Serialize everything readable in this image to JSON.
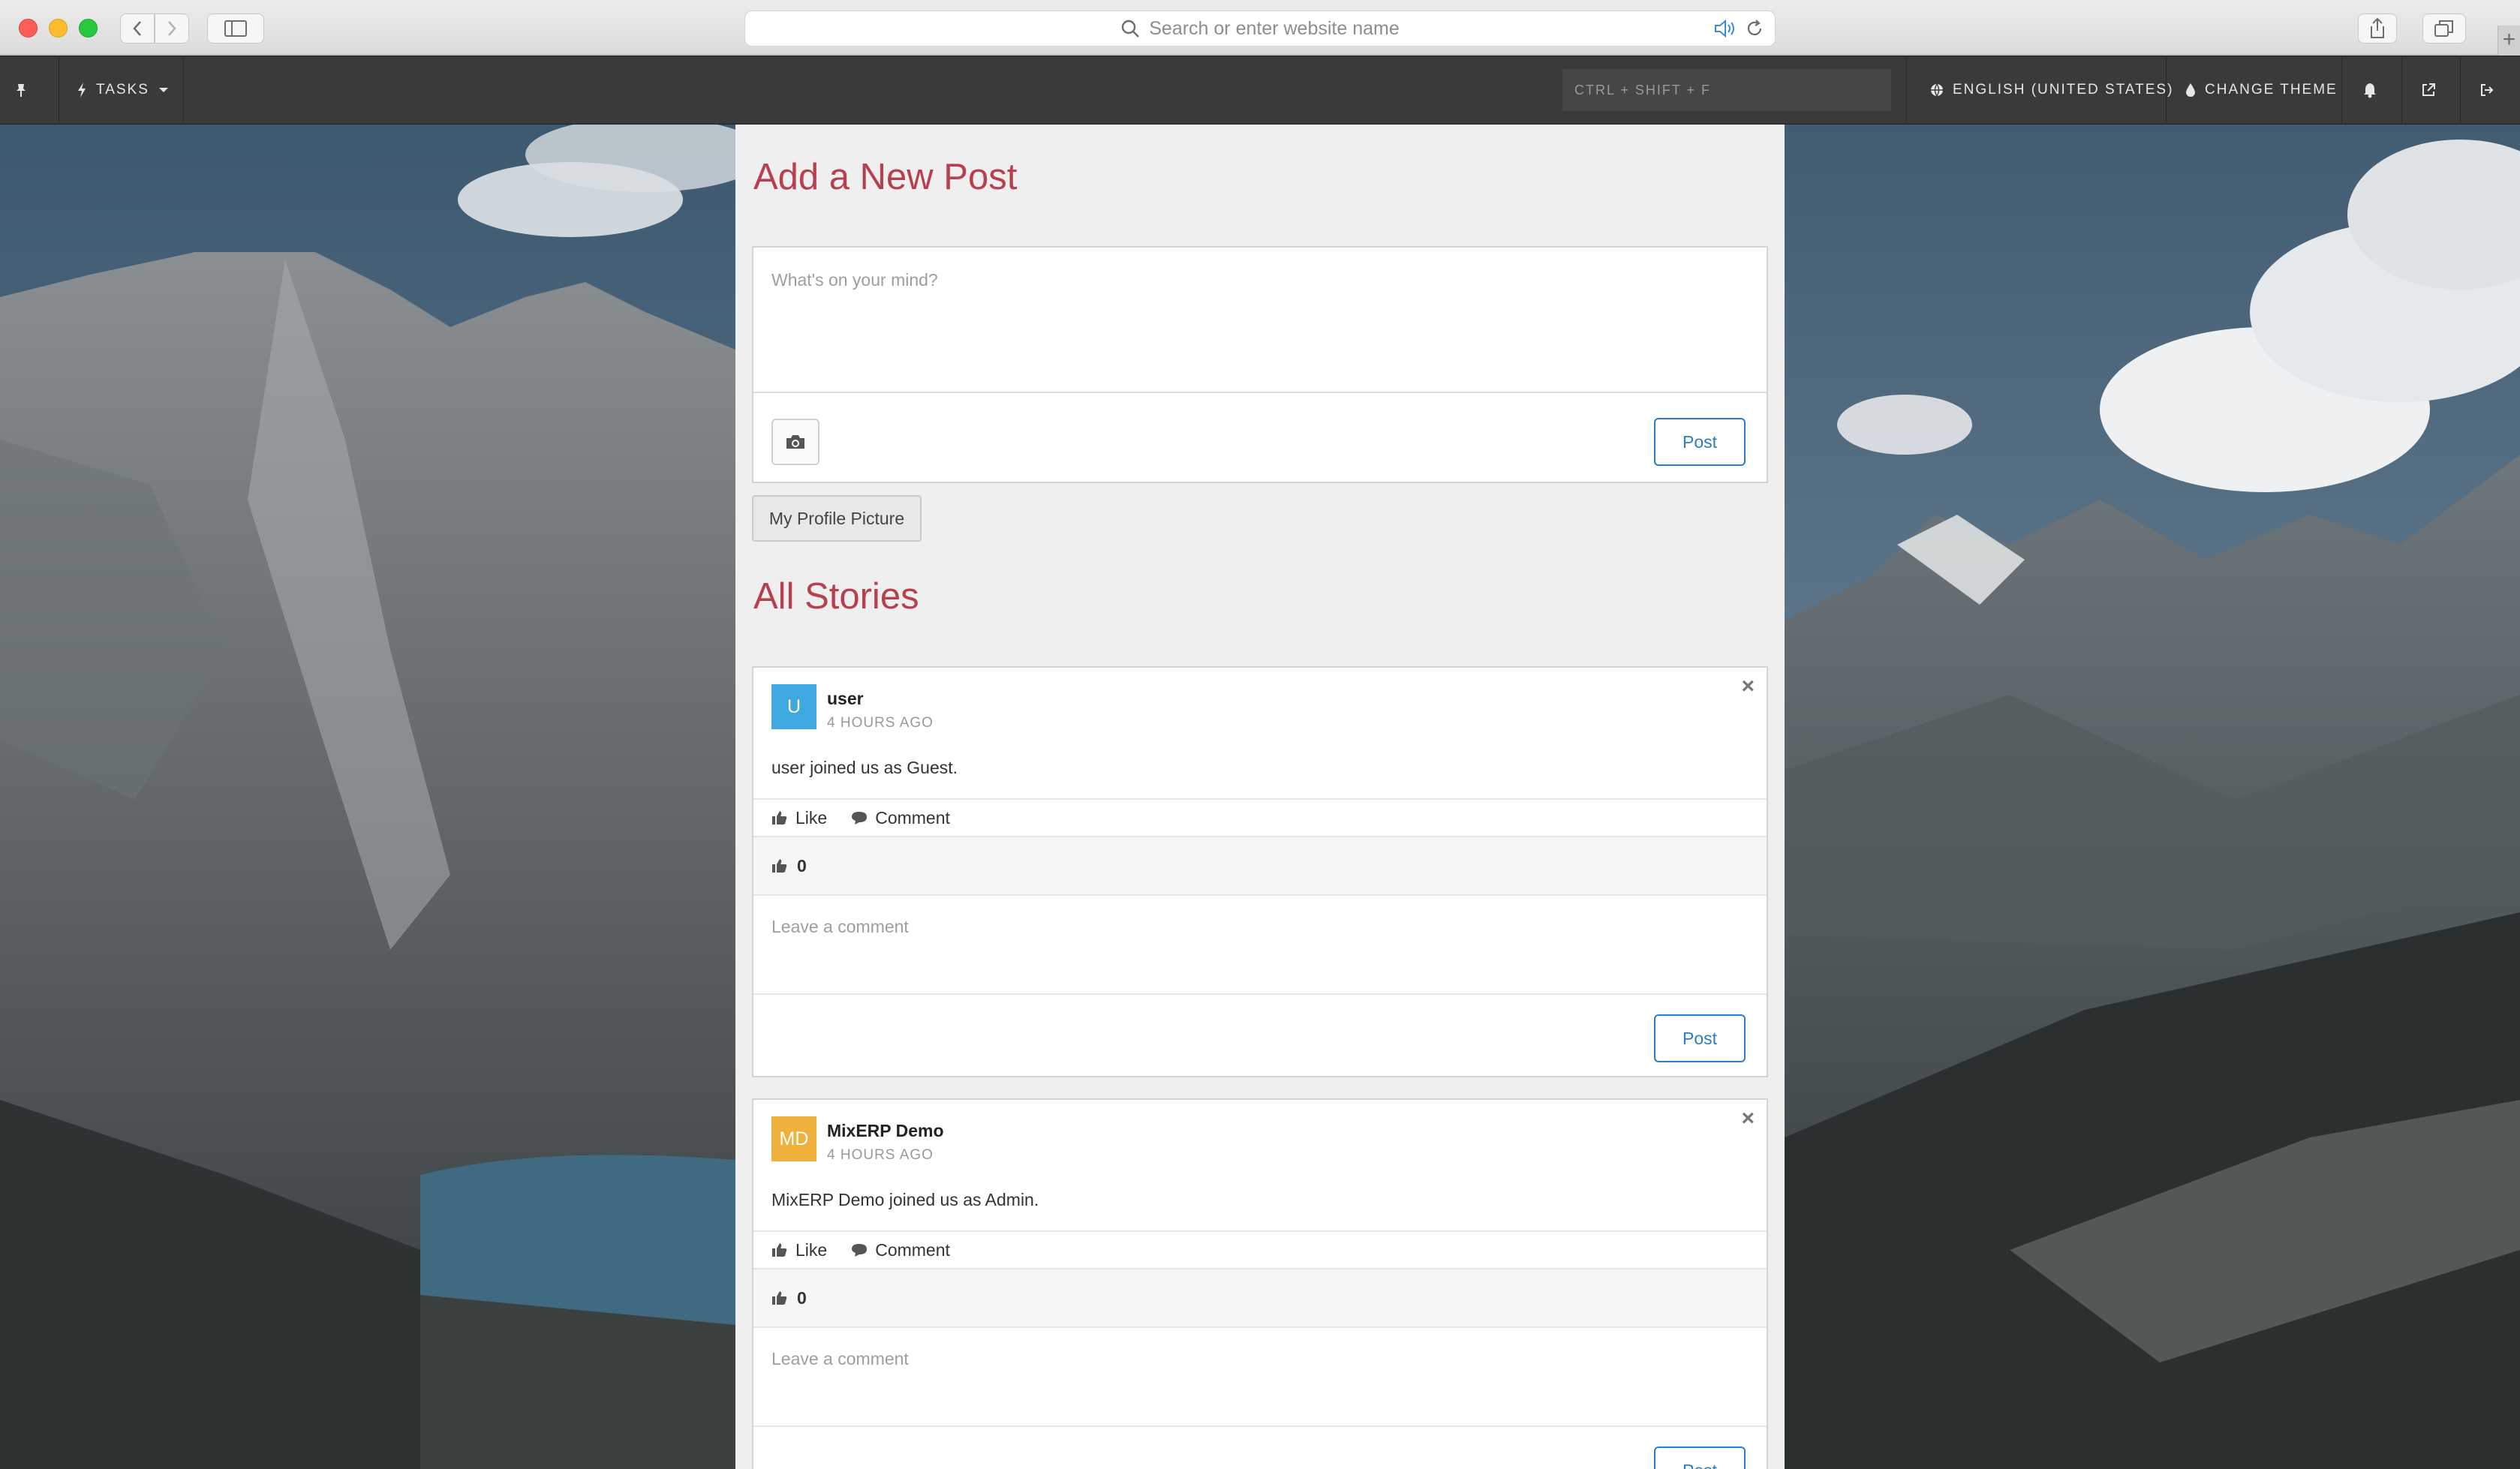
{
  "browser": {
    "address_placeholder": "Search or enter website name"
  },
  "app_nav": {
    "tasks_label": "TASKS",
    "shortcut_placeholder": "CTRL + SHIFT + F",
    "language_label": "ENGLISH (UNITED STATES)",
    "theme_label": "CHANGE THEME"
  },
  "new_post": {
    "heading": "Add a New Post",
    "placeholder": "What's on your mind?",
    "post_label": "Post",
    "profile_picture_label": "My Profile Picture"
  },
  "stories": {
    "heading": "All Stories",
    "items": [
      {
        "initials": "U",
        "avatar_color": "#3ea8e0",
        "author": "user",
        "time": "4 HOURS AGO",
        "message": "user joined us as Guest.",
        "like_label": "Like",
        "comment_label": "Comment",
        "likes": "0",
        "comment_placeholder": "Leave a comment",
        "post_label": "Post"
      },
      {
        "initials": "MD",
        "avatar_color": "#f0b03c",
        "author": "MixERP Demo",
        "time": "4 HOURS AGO",
        "message": "MixERP Demo joined us as Admin.",
        "like_label": "Like",
        "comment_label": "Comment",
        "likes": "0",
        "comment_placeholder": "Leave a comment",
        "post_label": "Post"
      }
    ]
  },
  "colors": {
    "heading": "#b8404e",
    "post_button": "#2a7dc4",
    "nav_bar": "#3a3a3a"
  }
}
